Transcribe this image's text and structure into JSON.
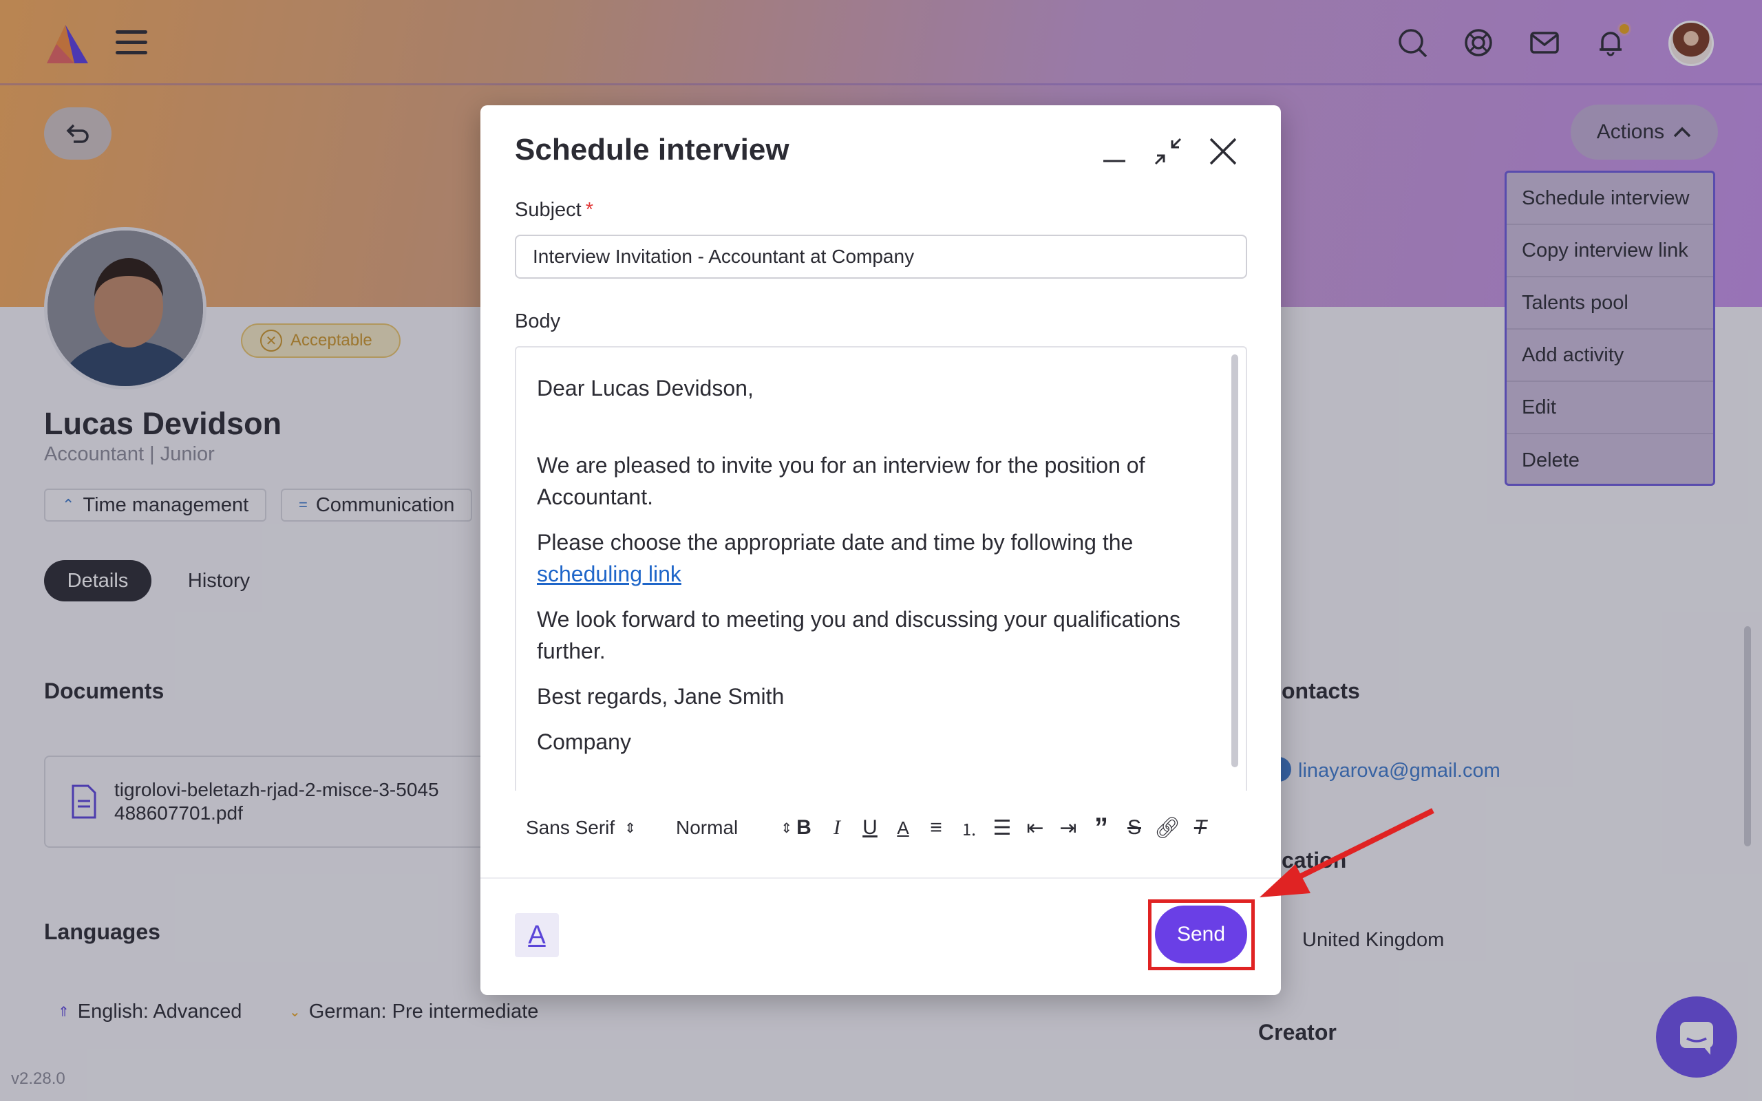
{
  "topbar": {
    "icons": [
      "search-icon",
      "support-icon",
      "mail-icon",
      "bell-icon"
    ],
    "notification_dot_color": "#e6a21e"
  },
  "actions": {
    "label": "Actions",
    "menu": [
      "Schedule interview",
      "Copy interview link",
      "Talents pool",
      "Add activity",
      "Edit",
      "Delete"
    ]
  },
  "candidate": {
    "status": "Acceptable",
    "name": "Lucas Devidson",
    "role": "Accountant | Junior",
    "skills": [
      "Time management",
      "Communication"
    ]
  },
  "tabs": [
    "Details",
    "History"
  ],
  "documents": {
    "title": "Documents",
    "file_line1": "tigrolovi-beletazh-rjad-2-misce-3-5045",
    "file_line2": "488607701.pdf"
  },
  "languages": {
    "title": "Languages",
    "items": [
      "English: Advanced",
      "German: Pre intermediate"
    ]
  },
  "contacts": {
    "title_partial": "ontacts",
    "email": "linayarova@gmail.com",
    "location_partial": "cation",
    "country": "United Kingdom",
    "creator_title": "Creator"
  },
  "version": "v2.28.0",
  "modal": {
    "title": "Schedule interview",
    "subject_label": "Subject",
    "required_mark": "*",
    "subject_value": "Interview Invitation - Accountant at Company",
    "body_label": "Body",
    "body": {
      "greeting": "Dear Lucas Devidson,",
      "p1": "We are pleased to invite you for an interview for the position of Accountant.",
      "p2_text": "Please choose the appropriate date and time by following the ",
      "p2_link": "scheduling link",
      "p3": "We look forward to meeting you and discussing your qualifications further.",
      "p4": "Best regards, Jane Smith",
      "p5": "Company"
    },
    "toolbar": {
      "font": "Sans Serif",
      "size": "Normal",
      "buttons": [
        "bold-icon",
        "italic-icon",
        "underline-icon",
        "text-color-icon",
        "align-icon",
        "ordered-list-icon",
        "bullet-list-icon",
        "outdent-icon",
        "indent-icon",
        "quote-icon",
        "strikethrough-icon",
        "link-icon",
        "clear-format-icon"
      ]
    },
    "font_toggle": "A",
    "send_label": "Send"
  },
  "colors": {
    "accent": "#6a3fe6",
    "highlight": "#e02323",
    "link": "#1f66c9"
  }
}
